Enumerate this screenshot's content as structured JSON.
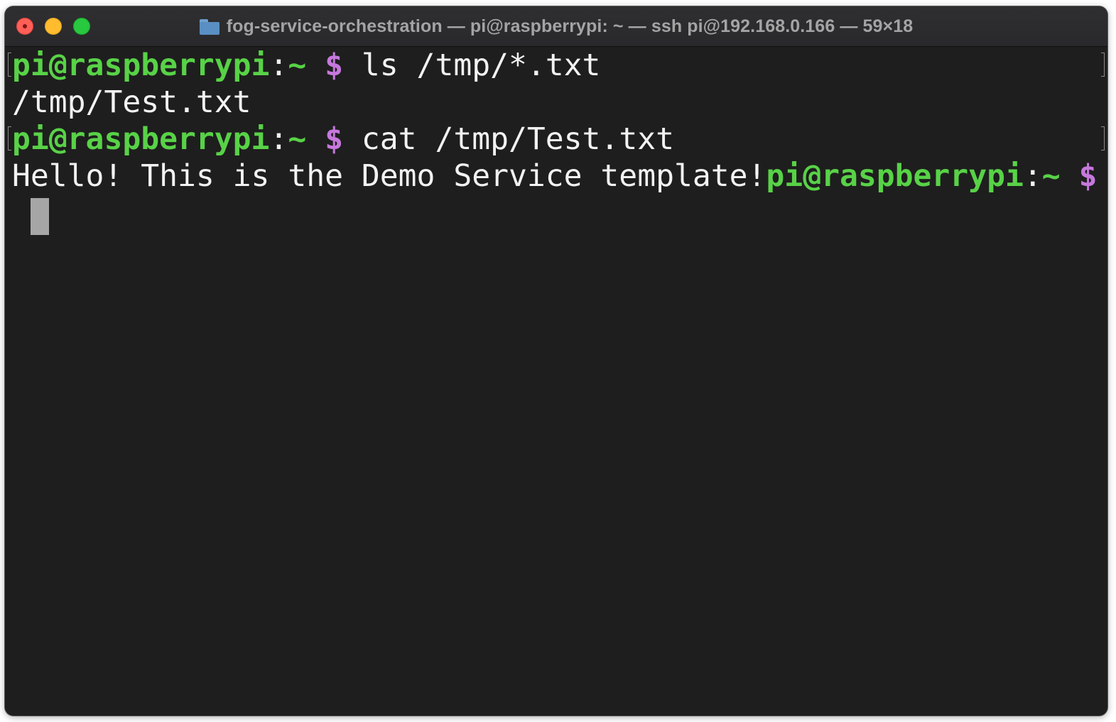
{
  "window": {
    "title": "fog-service-orchestration — pi@raspberrypi: ~ — ssh pi@192.168.0.166 — 59×18",
    "title_icon": "folder-icon",
    "controls": [
      "close-icon",
      "minimize-icon",
      "zoom-icon"
    ]
  },
  "terminal": {
    "prompt": {
      "user": "pi@raspberrypi",
      "colon": ":",
      "path": "~",
      "symbol": "$"
    },
    "lines": [
      {
        "command": "ls /tmp/*.txt"
      },
      {
        "output": "/tmp/Test.txt"
      },
      {
        "command": "cat /tmp/Test.txt"
      },
      {
        "output": "Hello! This is the Demo Service template!"
      }
    ]
  },
  "colors": {
    "background": "#1e1e1e",
    "prompt_user": "#58d247",
    "prompt_symbol": "#c678dd",
    "text": "#f2f2f2",
    "cursor": "#a6a6a6"
  }
}
